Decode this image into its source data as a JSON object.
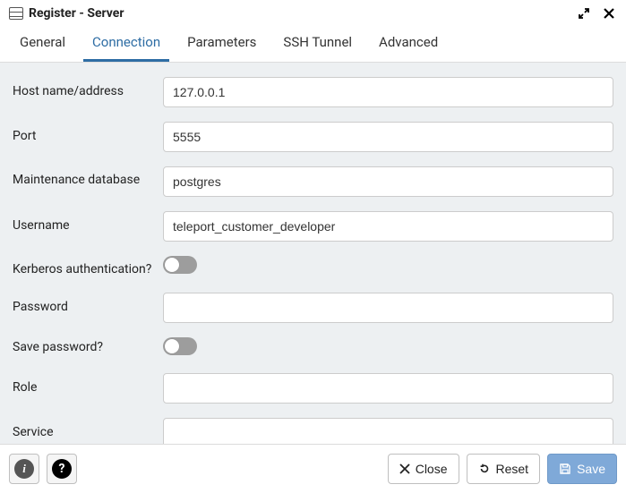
{
  "window": {
    "title": "Register - Server"
  },
  "tabs": [
    {
      "label": "General"
    },
    {
      "label": "Connection"
    },
    {
      "label": "Parameters"
    },
    {
      "label": "SSH Tunnel"
    },
    {
      "label": "Advanced"
    }
  ],
  "active_tab_index": 1,
  "form": {
    "host_label": "Host name/address",
    "host_value": "127.0.0.1",
    "port_label": "Port",
    "port_value": "5555",
    "maintdb_label": "Maintenance database",
    "maintdb_value": "postgres",
    "username_label": "Username",
    "username_value": "teleport_customer_developer",
    "kerberos_label": "Kerberos authentication?",
    "kerberos_on": false,
    "password_label": "Password",
    "password_value": "",
    "savepw_label": "Save password?",
    "savepw_on": false,
    "role_label": "Role",
    "role_value": "",
    "service_label": "Service",
    "service_value": ""
  },
  "footer": {
    "close_label": "Close",
    "reset_label": "Reset",
    "save_label": "Save"
  }
}
